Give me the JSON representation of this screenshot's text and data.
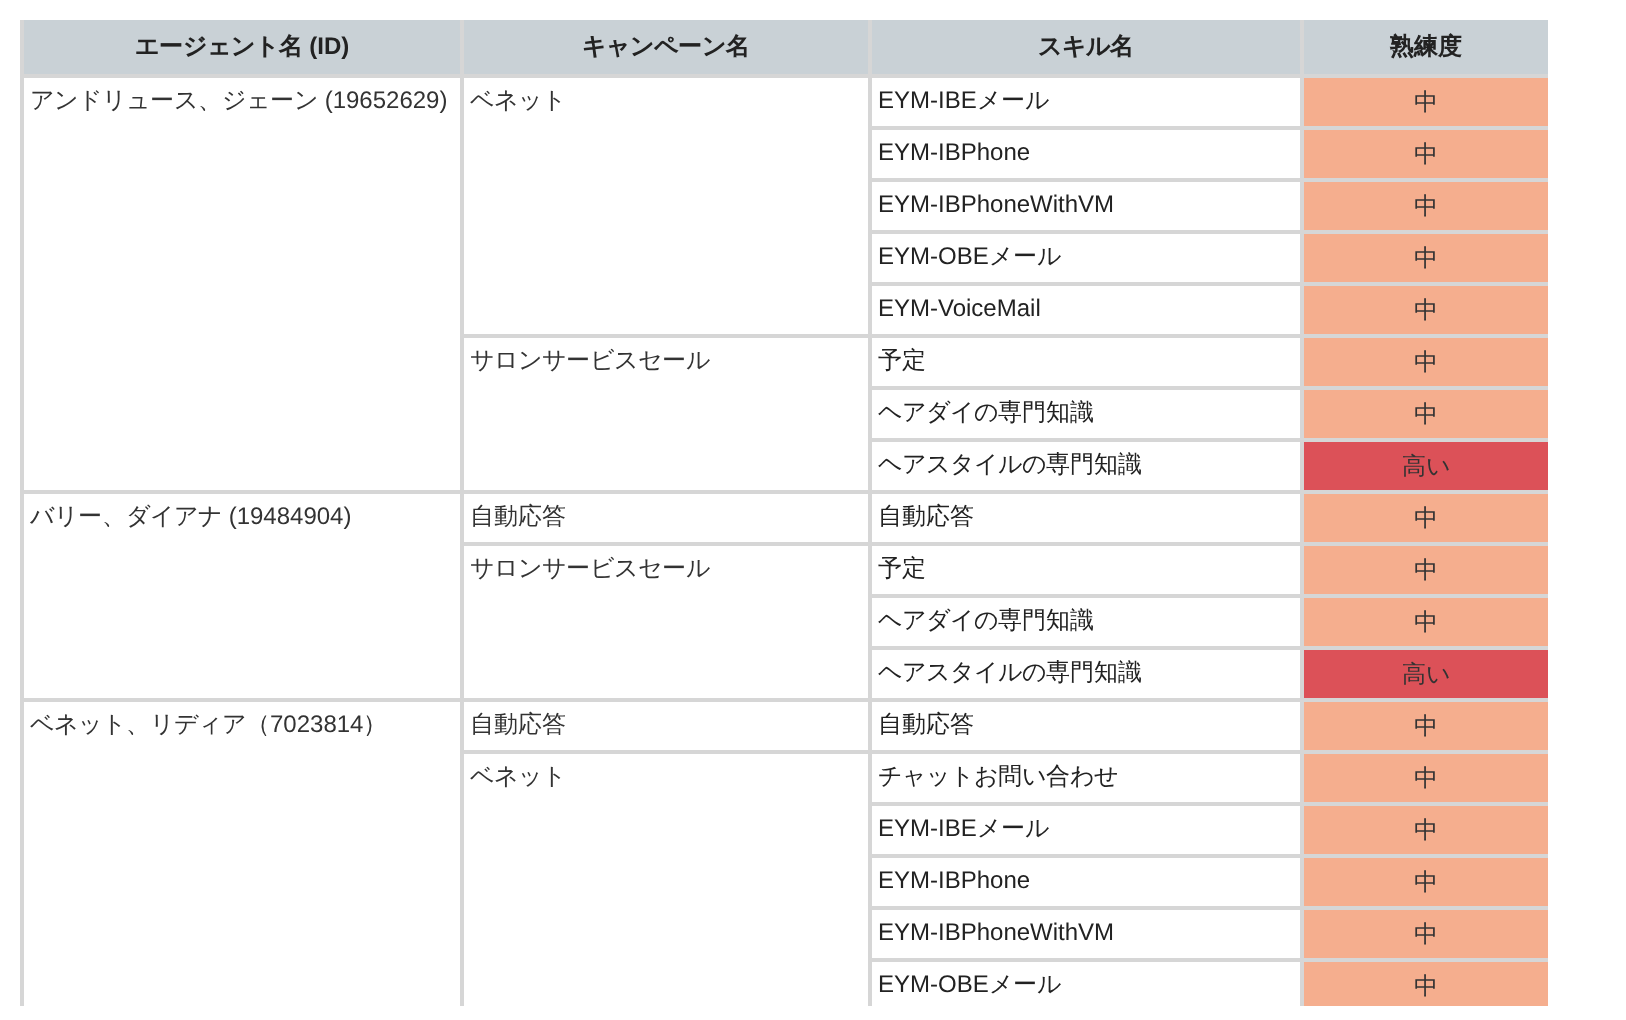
{
  "table": {
    "columns": [
      "エージェント名 (ID)",
      "キャンペーン名",
      "スキル名",
      "熟練度"
    ],
    "agents": [
      {
        "agent": "アンドリュース、ジェーン (19652629)",
        "campaigns": [
          {
            "name": "ベネット",
            "skills": [
              {
                "name": "EYM-IBEメール",
                "proficiency": "中",
                "color": "#f5ae8e"
              },
              {
                "name": "EYM-IBPhone",
                "proficiency": "中",
                "color": "#f5ae8e"
              },
              {
                "name": "EYM-IBPhoneWithVM",
                "proficiency": "中",
                "color": "#f5ae8e"
              },
              {
                "name": "EYM-OBEメール",
                "proficiency": "中",
                "color": "#f5ae8e"
              },
              {
                "name": "EYM-VoiceMail",
                "proficiency": "中",
                "color": "#f5ae8e"
              }
            ]
          },
          {
            "name": "サロンサービスセール",
            "skills": [
              {
                "name": "予定",
                "proficiency": "中",
                "color": "#f5ae8e"
              },
              {
                "name": "ヘアダイの専門知識",
                "proficiency": "中",
                "color": "#f5ae8e"
              },
              {
                "name": "ヘアスタイルの専門知識",
                "proficiency": "高い",
                "color": "#dc5158"
              }
            ]
          }
        ]
      },
      {
        "agent": "バリー、ダイアナ (19484904)",
        "campaigns": [
          {
            "name": "自動応答",
            "skills": [
              {
                "name": "自動応答",
                "proficiency": "中",
                "color": "#f5ae8e"
              }
            ]
          },
          {
            "name": "サロンサービスセール",
            "skills": [
              {
                "name": "予定",
                "proficiency": "中",
                "color": "#f5ae8e"
              },
              {
                "name": "ヘアダイの専門知識",
                "proficiency": "中",
                "color": "#f5ae8e"
              },
              {
                "name": "ヘアスタイルの専門知識",
                "proficiency": "高い",
                "color": "#dc5158"
              }
            ]
          }
        ]
      },
      {
        "agent": "ベネット、リディア（7023814）",
        "campaigns": [
          {
            "name": "自動応答",
            "skills": [
              {
                "name": "自動応答",
                "proficiency": "中",
                "color": "#f5ae8e"
              }
            ]
          },
          {
            "name": "ベネット",
            "skills": [
              {
                "name": "チャットお問い合わせ",
                "proficiency": "中",
                "color": "#f5ae8e"
              },
              {
                "name": "EYM-IBEメール",
                "proficiency": "中",
                "color": "#f5ae8e"
              },
              {
                "name": "EYM-IBPhone",
                "proficiency": "中",
                "color": "#f5ae8e"
              },
              {
                "name": "EYM-IBPhoneWithVM",
                "proficiency": "中",
                "color": "#f5ae8e"
              },
              {
                "name": "EYM-OBEメール",
                "proficiency": "中",
                "color": "#f5ae8e"
              }
            ]
          }
        ]
      }
    ]
  }
}
